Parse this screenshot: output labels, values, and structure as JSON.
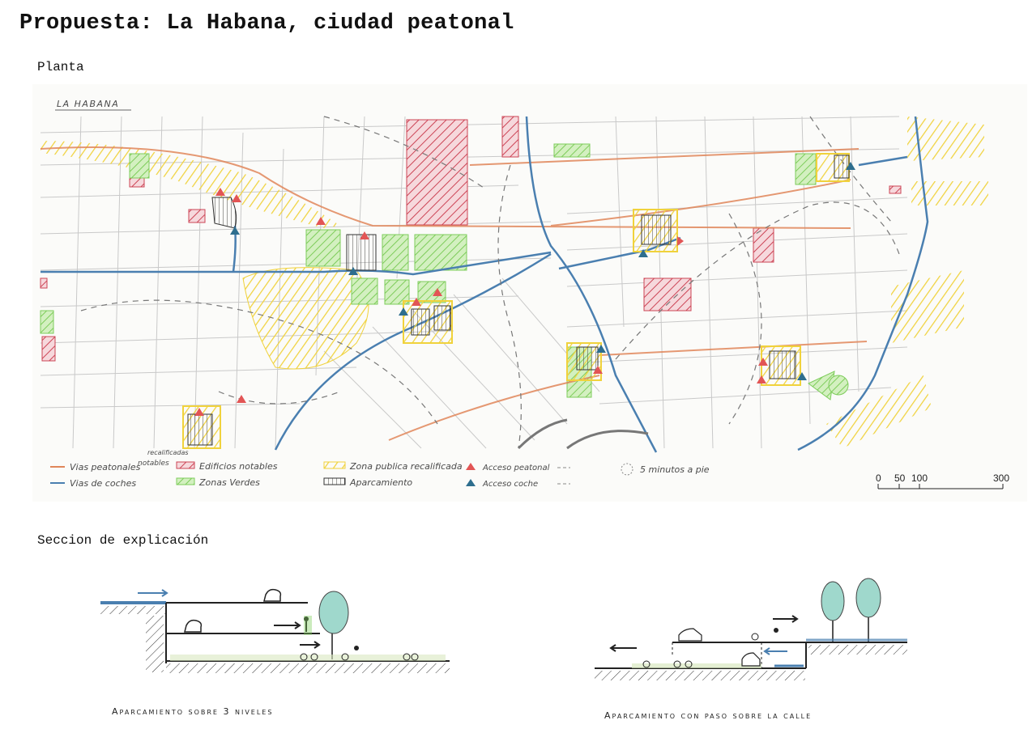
{
  "title": "Propuesta: La Habana, ciudad peatonal",
  "plan": {
    "heading": "Planta",
    "map_label": "LA HABANA",
    "legend": {
      "pedestrian_roads": "Vias peatonales",
      "car_roads": "Vias de coches",
      "notable_buildings_top": "recalificadas",
      "notable_buildings_mid": "notables",
      "notable_buildings": "Edificios notables",
      "green_zones": "Zonas Verdes",
      "public_zone": "Zona publica recalificada",
      "parking": "Aparcamiento",
      "ped_access": "Acceso peatonal",
      "car_access": "Acceso coche",
      "walk_radius": "5 minutos a pie"
    },
    "scale": {
      "ticks": [
        "0",
        "50",
        "100",
        "300"
      ]
    },
    "colors": {
      "pedestrian": "#e0865a",
      "cars": "#4a7fb0",
      "notable": "#cc4455",
      "green": "#7dcc5a",
      "public": "#f0d23c",
      "parking": "#333333"
    }
  },
  "section": {
    "heading": "Seccion de explicación",
    "caption_left": "Aparcamiento sobre 3 niveles",
    "caption_right": "Aparcamiento con paso sobre la calle"
  }
}
